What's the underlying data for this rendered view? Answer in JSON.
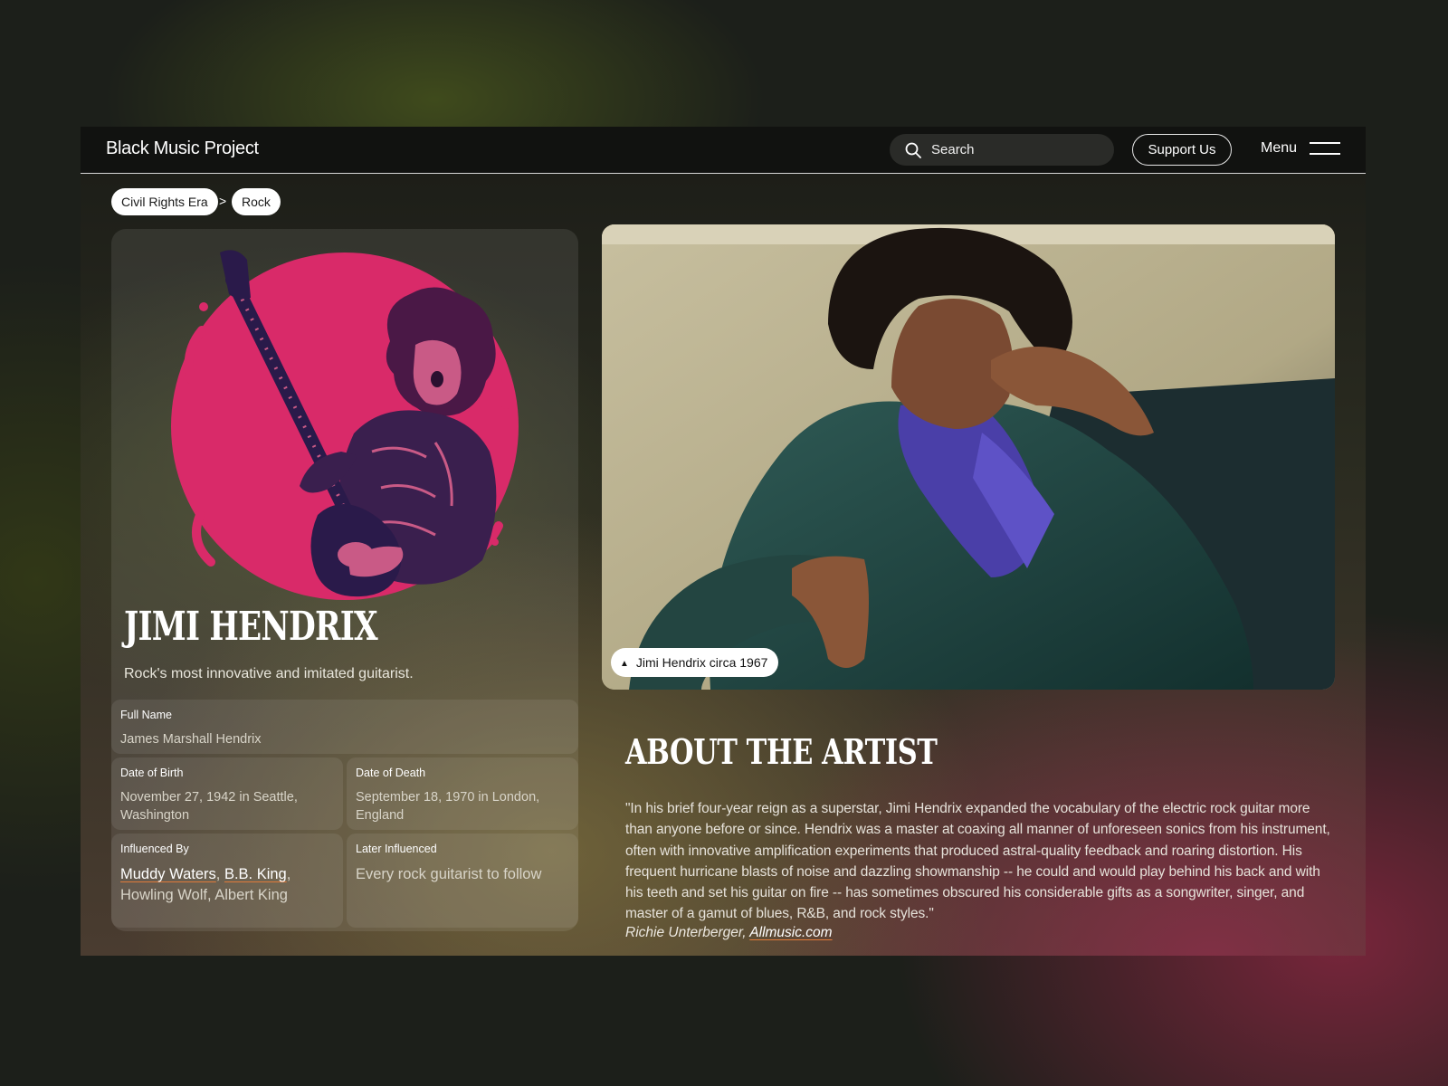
{
  "header": {
    "brand": "Black Music Project",
    "search_placeholder": "Search",
    "support_label": "Support Us",
    "menu_label": "Menu"
  },
  "breadcrumb": {
    "items": [
      "Civil Rights Era",
      "Rock"
    ],
    "separator": ">"
  },
  "artist": {
    "name": "JIMI HENDRIX",
    "tagline": "Rock's most innovative and imitated guitarist.",
    "illustration_icon": "guitarist-illustration-icon"
  },
  "facts": {
    "full_name": {
      "label": "Full Name",
      "value": "James Marshall Hendrix"
    },
    "birth": {
      "label": "Date of Birth",
      "value": "November 27, 1942 in Seattle, Washington"
    },
    "death": {
      "label": "Date of Death",
      "value": "September 18, 1970 in London, England"
    },
    "influenced_by": {
      "label": "Influenced By",
      "links": [
        "Muddy Waters",
        "B.B. King"
      ],
      "rest": "Howling Wolf, Albert King"
    },
    "later_influenced": {
      "label": "Later Influenced",
      "value": "Every rock guitarist to follow"
    }
  },
  "photo": {
    "caption": "Jimi Hendrix circa 1967",
    "caption_icon": "triangle-up-icon"
  },
  "about": {
    "title": "ABOUT THE ARTIST",
    "quote": "\"In his brief four-year reign as a superstar, Jimi Hendrix expanded the vocabulary of the electric rock guitar more than anyone before or since. Hendrix was a master at coaxing all manner of unforeseen sonics from his instrument, often with innovative amplification experiments that produced astral-quality feedback and roaring distortion. His frequent hurricane blasts of noise and dazzling showmanship -- he could and would play behind his back and with his teeth and set his guitar on fire -- has sometimes obscured his considerable gifts as a songwriter, singer, and master of a gamut of blues, R&B, and rock styles.\"",
    "credit_author": "Richie Unterberger, ",
    "credit_source": "Allmusic.com"
  },
  "colors": {
    "accent_pink": "#d92a69",
    "illustration_ink": "#2a1a4a",
    "link_underline": "#e07a3a",
    "header_bg": "#111210"
  }
}
